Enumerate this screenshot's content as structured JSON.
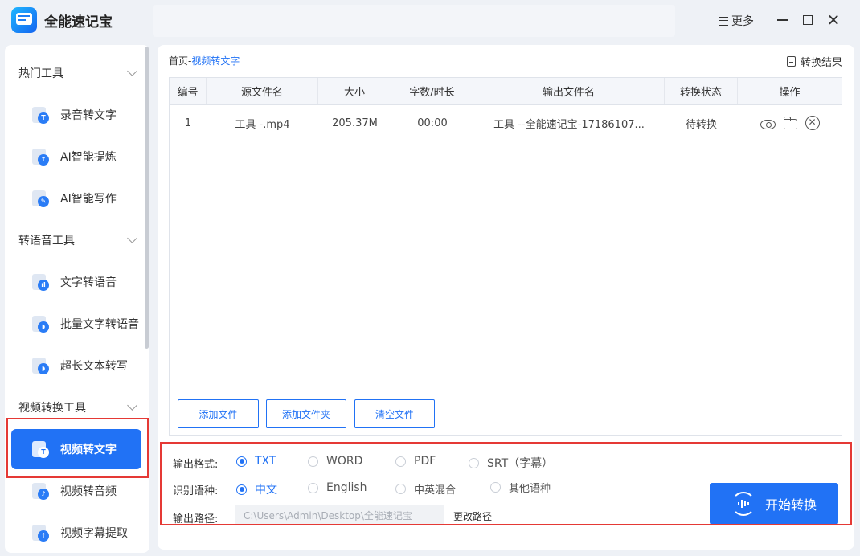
{
  "app": {
    "title": "全能速记宝",
    "more_label": "更多"
  },
  "sidebar": {
    "groups": [
      {
        "label": "热门工具",
        "items": [
          {
            "label": "录音转文字",
            "badge": "T"
          },
          {
            "label": "AI智能提炼",
            "badge": "↑"
          },
          {
            "label": "AI智能写作",
            "badge": "✎"
          }
        ]
      },
      {
        "label": "转语音工具",
        "items": [
          {
            "label": "文字转语音",
            "badge": "ıl"
          },
          {
            "label": "批量文字转语音",
            "badge": "◗"
          },
          {
            "label": "超长文本转写",
            "badge": "◗"
          }
        ]
      },
      {
        "label": "视频转换工具",
        "items": [
          {
            "label": "视频转文字",
            "badge": "T",
            "active": true
          },
          {
            "label": "视频转音频",
            "badge": "♪"
          },
          {
            "label": "视频字幕提取",
            "badge": "↑"
          }
        ]
      }
    ]
  },
  "breadcrumb": {
    "home": "首页",
    "sep": "-",
    "current": "视频转文字"
  },
  "result_link": "转换结果",
  "table": {
    "headers": [
      "编号",
      "源文件名",
      "大小",
      "字数/时长",
      "输出文件名",
      "转换状态",
      "操作"
    ],
    "rows": [
      {
        "id": "1",
        "source": "工具 -.mp4",
        "size": "205.37M",
        "duration": "00:00",
        "output": "工具 --全能速记宝-17186107...",
        "status": "待转换"
      }
    ]
  },
  "buttons": {
    "add_file": "添加文件",
    "add_folder": "添加文件夹",
    "clear_files": "清空文件",
    "change_path": "更改路径",
    "start": "开始转换"
  },
  "settings": {
    "format_label": "输出格式:",
    "formats": [
      "TXT",
      "WORD",
      "PDF",
      "SRT（字幕）"
    ],
    "selected_format": "TXT",
    "language_label": "识别语种:",
    "languages": [
      "中文",
      "English",
      "中英混合",
      "其他语种"
    ],
    "selected_language": "中文",
    "path_label": "输出路径:",
    "path_value": "C:\\Users\\Admin\\Desktop\\全能速记宝"
  },
  "colors": {
    "accent": "#2172f5",
    "highlight_box": "#e53935"
  }
}
